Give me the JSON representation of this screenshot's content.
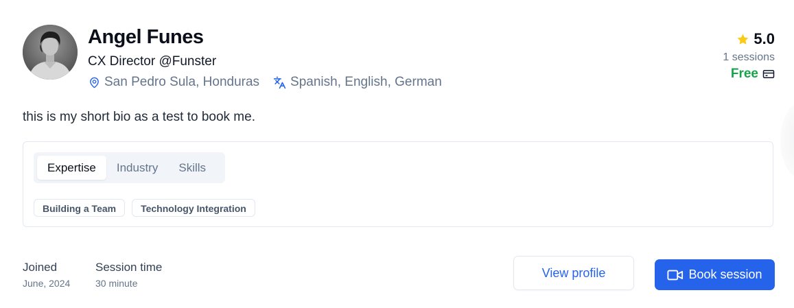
{
  "profile": {
    "name": "Angel Funes",
    "title": "CX Director @Funster",
    "location": "San Pedro Sula, Honduras",
    "languages": "Spanish, English, German",
    "bio": "this is my short bio as a test to book me.",
    "avatar_icon": "person-photo"
  },
  "stats": {
    "rating": "5.0",
    "sessions": "1 sessions",
    "price": "Free"
  },
  "tabs": [
    {
      "label": "Expertise",
      "active": true
    },
    {
      "label": "Industry",
      "active": false
    },
    {
      "label": "Skills",
      "active": false
    }
  ],
  "chips": [
    "Building a Team",
    "Technology Integration"
  ],
  "joined": {
    "label": "Joined",
    "value": "June, 2024"
  },
  "session_time": {
    "label": "Session time",
    "value": "30 minute"
  },
  "actions": {
    "view_profile": "View profile",
    "book_session": "Book session"
  },
  "colors": {
    "accent": "#2563eb",
    "free": "#16a34a",
    "star": "#facc15",
    "muted": "#64748b"
  }
}
